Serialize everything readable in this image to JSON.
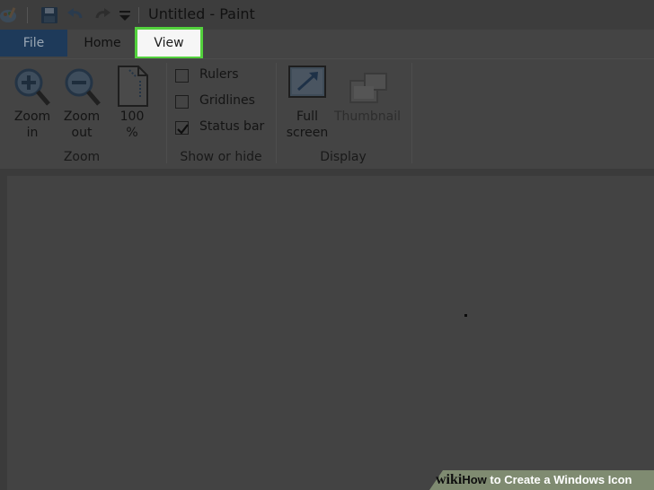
{
  "window": {
    "title": "Untitled - Paint"
  },
  "quick_access": {
    "icons": [
      "paint-app-icon",
      "save-icon",
      "undo-icon",
      "redo-icon",
      "customize-dropdown-icon"
    ]
  },
  "tabs": {
    "file": "File",
    "home": "Home",
    "view": "View",
    "active": "View"
  },
  "ribbon": {
    "zoom": {
      "group_label": "Zoom",
      "zoom_in": {
        "line1": "Zoom",
        "line2": "in"
      },
      "zoom_out": {
        "line1": "Zoom",
        "line2": "out"
      },
      "hundred": {
        "line1": "100",
        "line2": "%"
      }
    },
    "show_hide": {
      "group_label": "Show or hide",
      "rulers": {
        "label": "Rulers",
        "checked": false
      },
      "gridlines": {
        "label": "Gridlines",
        "checked": false
      },
      "status_bar": {
        "label": "Status bar",
        "checked": true
      }
    },
    "display": {
      "group_label": "Display",
      "full_screen": {
        "line1": "Full",
        "line2": "screen"
      },
      "thumbnail": {
        "label": "Thumbnail",
        "enabled": false
      }
    }
  },
  "watermark": {
    "wiki": "wiki",
    "how": "How",
    "rest": " to Create a Windows Icon"
  },
  "colors": {
    "file_tab": "#1e3a5a",
    "highlight": "#53d13d",
    "ribbon_bg": "#444444",
    "canvas_bg": "#434343"
  }
}
